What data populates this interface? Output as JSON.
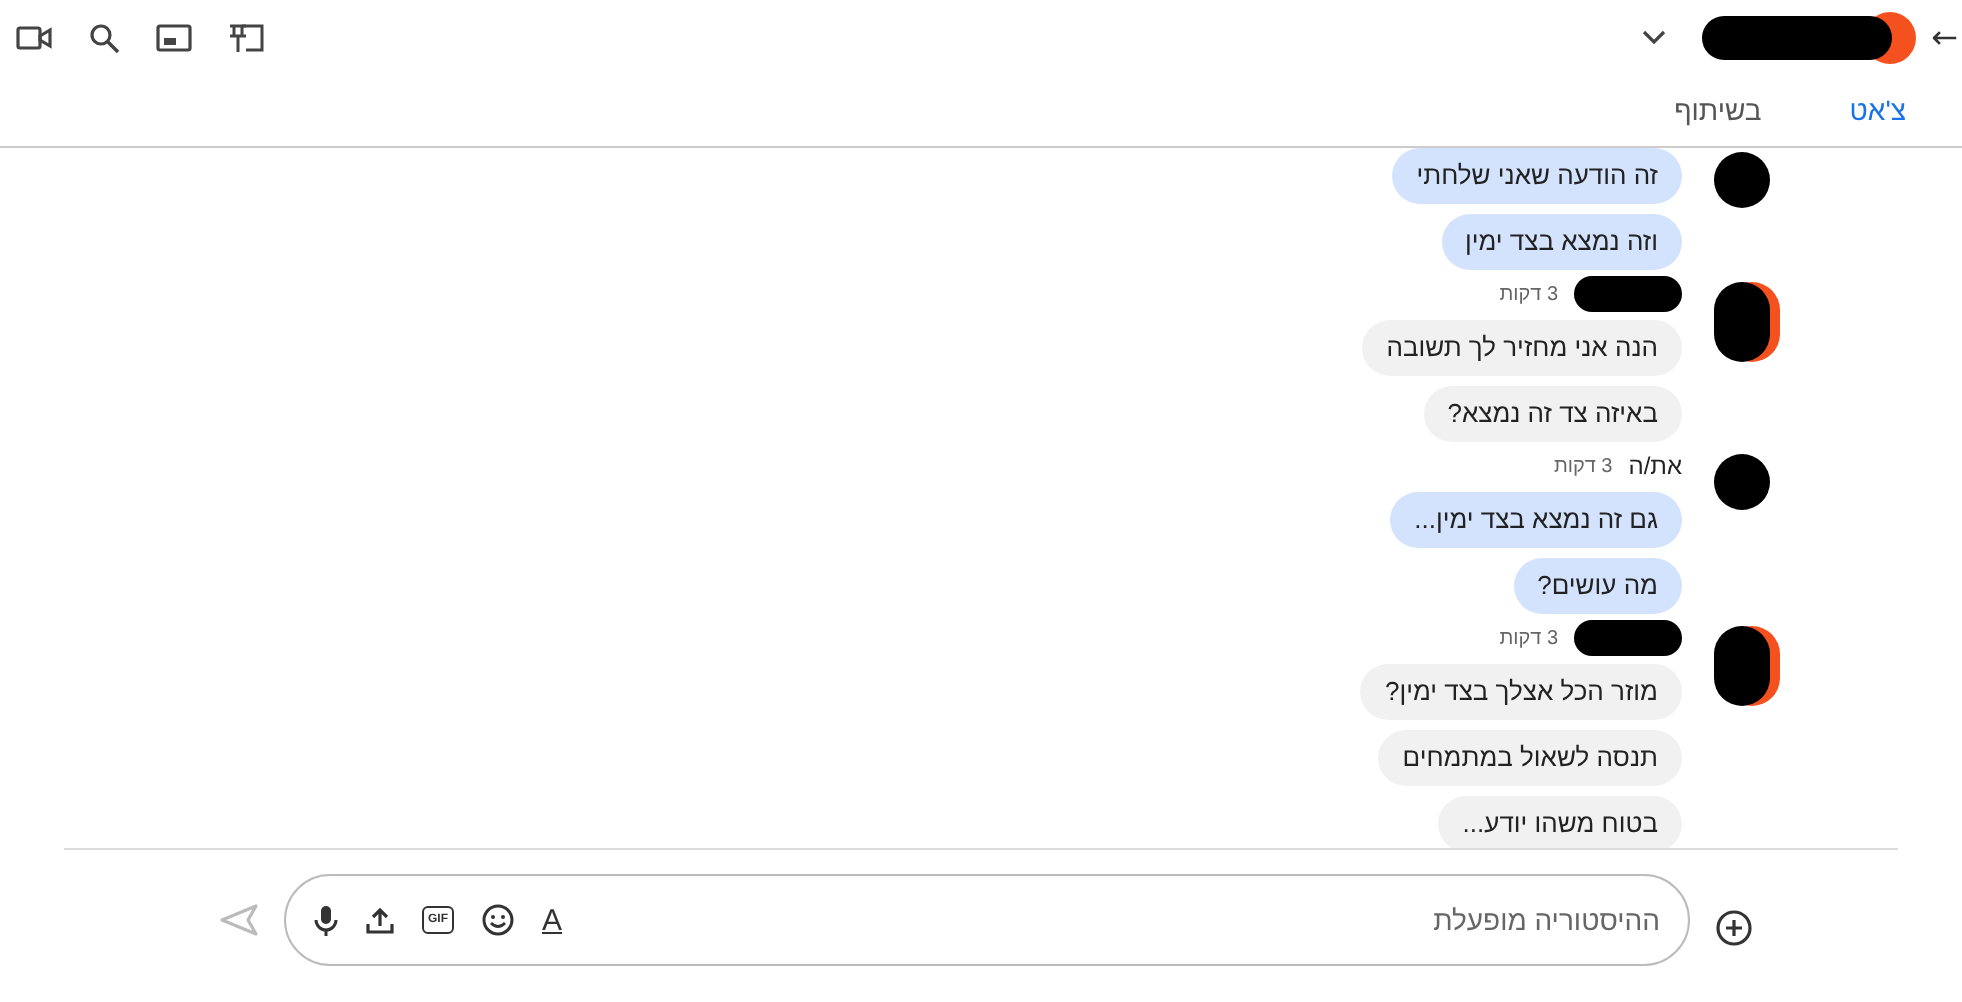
{
  "header": {
    "back": "←",
    "tabs": [
      {
        "label": "צ'אט",
        "selected": true
      },
      {
        "label": "בשיתוף",
        "selected": false
      }
    ]
  },
  "groups": [
    {
      "kind": "self",
      "messages": [
        "זה הודעה שאני שלחתי",
        "וזה נמצא בצד ימין"
      ]
    },
    {
      "kind": "other",
      "time": "3 דקות",
      "messages": [
        "הנה אני מחזיר לך תשובה",
        "באיזה צד זה נמצא?"
      ]
    },
    {
      "kind": "self",
      "name": "את/ה",
      "time": "3 דקות",
      "messages": [
        "גם זה נמצא בצד ימין...",
        "מה עושים?"
      ]
    },
    {
      "kind": "other",
      "time": "3 דקות",
      "messages": [
        "מוזר הכל אצלך בצד ימין?",
        "תנסה לשאול במתמחים",
        "בטוח משהו יודע..."
      ]
    }
  ],
  "composer": {
    "placeholder": "ההיסטוריה מופעלת",
    "gif": "GIF",
    "format": "A"
  }
}
